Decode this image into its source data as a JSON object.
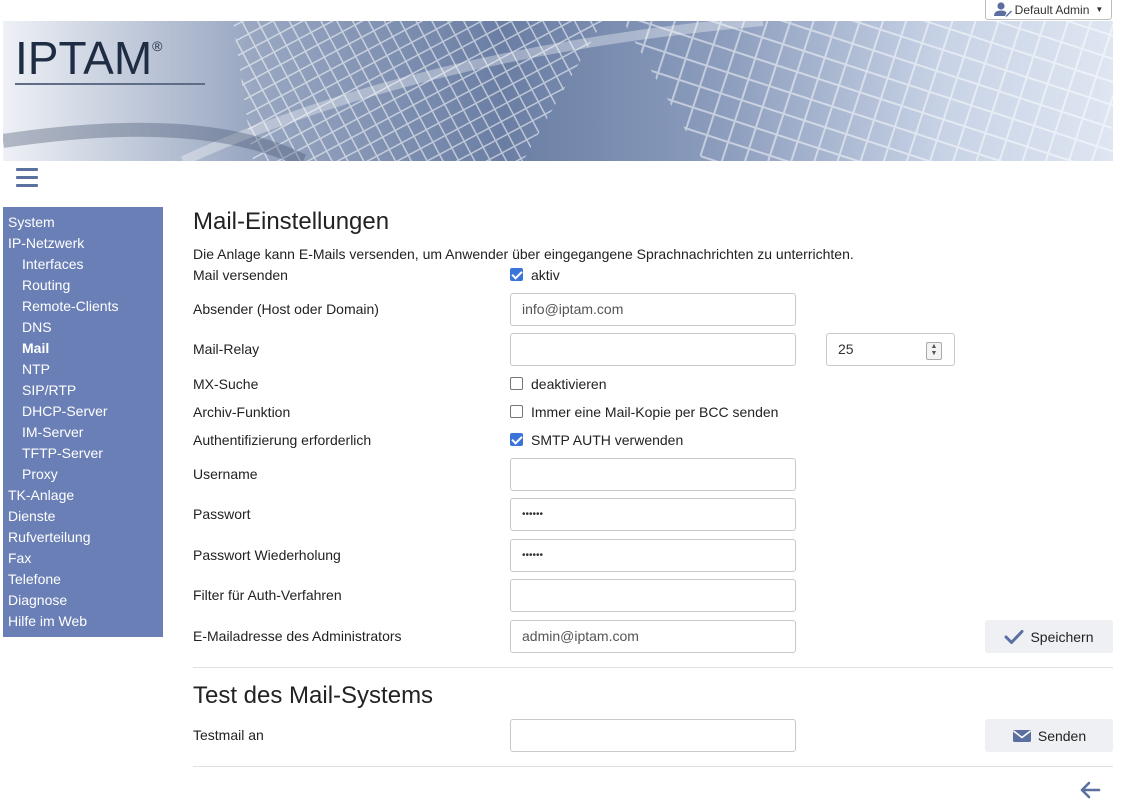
{
  "user_menu": {
    "label": "Default Admin"
  },
  "branding": {
    "logo_text": "IPTAM",
    "logo_mark": "®"
  },
  "sidebar": {
    "items": [
      {
        "label": "System",
        "level": 0,
        "active": false
      },
      {
        "label": "IP-Netzwerk",
        "level": 0,
        "active": false
      },
      {
        "label": "Interfaces",
        "level": 1,
        "active": false
      },
      {
        "label": "Routing",
        "level": 1,
        "active": false
      },
      {
        "label": "Remote-Clients",
        "level": 1,
        "active": false
      },
      {
        "label": "DNS",
        "level": 1,
        "active": false
      },
      {
        "label": "Mail",
        "level": 1,
        "active": true
      },
      {
        "label": "NTP",
        "level": 1,
        "active": false
      },
      {
        "label": "SIP/RTP",
        "level": 1,
        "active": false
      },
      {
        "label": "DHCP-Server",
        "level": 1,
        "active": false
      },
      {
        "label": "IM-Server",
        "level": 1,
        "active": false
      },
      {
        "label": "TFTP-Server",
        "level": 1,
        "active": false
      },
      {
        "label": "Proxy",
        "level": 1,
        "active": false
      },
      {
        "label": "TK-Anlage",
        "level": 0,
        "active": false
      },
      {
        "label": "Dienste",
        "level": 0,
        "active": false
      },
      {
        "label": "Rufverteilung",
        "level": 0,
        "active": false
      },
      {
        "label": "Fax",
        "level": 0,
        "active": false
      },
      {
        "label": "Telefone",
        "level": 0,
        "active": false
      },
      {
        "label": "Diagnose",
        "level": 0,
        "active": false
      },
      {
        "label": "Hilfe im Web",
        "level": 0,
        "active": false
      }
    ]
  },
  "mail": {
    "title": "Mail-Einstellungen",
    "description": "Die Anlage kann E-Mails versenden, um Anwender über eingegangene Sprachnachrichten zu unterrichten.",
    "send": {
      "label": "Mail versenden",
      "checkbox_label": "aktiv",
      "checked": true
    },
    "sender": {
      "label": "Absender (Host oder Domain)",
      "value": "info@iptam.com"
    },
    "relay": {
      "label": "Mail-Relay",
      "value": "",
      "port": "25"
    },
    "mx": {
      "label": "MX-Suche",
      "checkbox_label": "deaktivieren",
      "checked": false
    },
    "archive": {
      "label": "Archiv-Funktion",
      "checkbox_label": "Immer eine Mail-Kopie per BCC senden",
      "checked": false
    },
    "auth": {
      "label": "Authentifizierung erforderlich",
      "checkbox_label": "SMTP AUTH verwenden",
      "checked": true
    },
    "username": {
      "label": "Username",
      "value": ""
    },
    "password": {
      "label": "Passwort",
      "value": "••••••"
    },
    "password_repeat": {
      "label": "Passwort Wiederholung",
      "value": "••••••"
    },
    "auth_filter": {
      "label": "Filter für Auth-Verfahren",
      "value": ""
    },
    "admin_email": {
      "label": "E-Mailadresse des Administrators",
      "value": "admin@iptam.com"
    },
    "save_label": "Speichern"
  },
  "test": {
    "title": "Test des Mail-Systems",
    "label": "Testmail an",
    "value": "",
    "send_label": "Senden"
  },
  "colors": {
    "sidebar": "#6a7fb5",
    "accent": "#3b74d9",
    "icon": "#5b6fa0"
  }
}
